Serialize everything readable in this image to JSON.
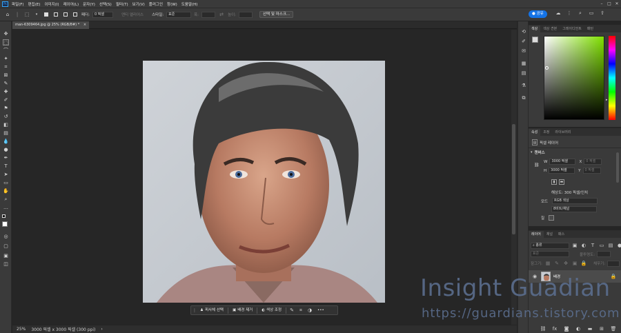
{
  "menu": {
    "app_badge": "Ps",
    "items": [
      "파일(F)",
      "편집(E)",
      "이미지(I)",
      "레이어(L)",
      "문자(Y)",
      "선택(S)",
      "필터(T)",
      "보기(V)",
      "플러그인",
      "창(W)",
      "도움말(H)"
    ]
  },
  "options": {
    "feather_label": "페더:",
    "feather_value": "0 픽셀",
    "antialias_label": "앤티 앨리어스",
    "style_label": "스타일:",
    "style_value": "표준",
    "width_label": "폭:",
    "height_label": "높이:",
    "select_mask_button": "선택 및 마스크...",
    "share_button": "공유"
  },
  "document": {
    "tab_title": "man-6309464.jpg @ 25% (RGB/8#) *",
    "close_glyph": "×"
  },
  "status": {
    "zoom": "25%",
    "info": "3000 픽셀 x 3000 픽셀 (300 ppi)"
  },
  "contextual_taskbar": {
    "select_subject": "피사체 선택",
    "remove_background": "배경 제거",
    "color_adjust": "색상 조정",
    "more": "•••"
  },
  "color_panel": {
    "tabs": [
      "색상",
      "색상 견본",
      "그레이디언트",
      "패턴"
    ],
    "hue_color": "#7fe000"
  },
  "properties_panel": {
    "tabs": [
      "속성",
      "조정",
      "라이브러리"
    ],
    "type_label": "픽셀 레이어",
    "section_title": "캔버스",
    "w_label": "W",
    "w_value": "3000 픽셀",
    "h_label": "H",
    "h_value": "3000 픽셀",
    "x_label": "X",
    "x_value": "0 픽셀",
    "y_label": "Y",
    "y_value": "0 픽셀",
    "resolution": "해상도: 300 픽셀/인치",
    "mode_label": "모드",
    "mode_value": "RGB 색상",
    "bit_depth": "8비트/채널",
    "fill_label": "칠"
  },
  "layers_panel": {
    "tabs": [
      "레이어",
      "채널",
      "패스"
    ],
    "search_placeholder": "종류",
    "blend_mode": "표준",
    "opacity_label": "불투명도:",
    "lock_label": "잠그기:",
    "fill_label": "채우기:",
    "layer_name": "배경"
  },
  "watermark": {
    "title": "Insight Guadian",
    "url": "https://guardians.tistory.com"
  }
}
